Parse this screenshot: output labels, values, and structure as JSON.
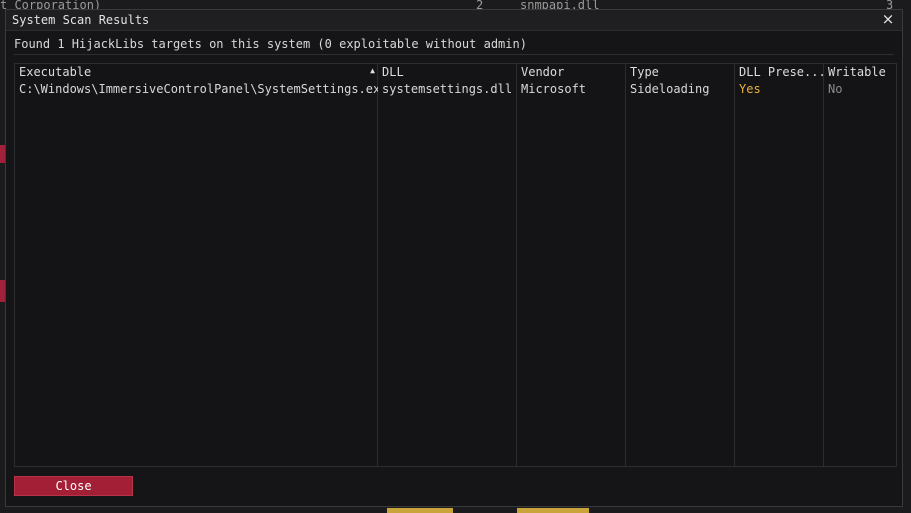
{
  "background": {
    "top_left_text": "t Corporation)",
    "top_mid_num": "2",
    "top_mid_dll": "snmpapi.dll",
    "top_right_num": "3"
  },
  "dialog": {
    "title": "System Scan Results",
    "close_icon": "×",
    "summary": "Found 1 HijackLibs targets on this system (0 exploitable without admin)",
    "close_button": "Close"
  },
  "table": {
    "headers": [
      "Executable",
      "DLL",
      "Vendor",
      "Type",
      "DLL Prese...",
      "Writable"
    ],
    "sort_icon": "▲",
    "rows": [
      {
        "executable": "C:\\Windows\\ImmersiveControlPanel\\SystemSettings.exe",
        "dll": "systemsettings.dll",
        "vendor": "Microsoft",
        "type": "Sideloading",
        "dll_present": "Yes",
        "writable": "No"
      }
    ]
  },
  "colors": {
    "accent_red": "#a31f36",
    "yes_color": "#e8b23a",
    "background": "#151517"
  }
}
